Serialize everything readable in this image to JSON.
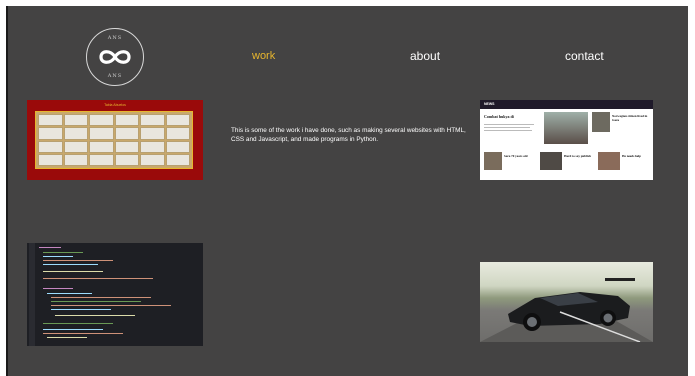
{
  "logo": {
    "top_text": "ANS",
    "bottom_text": "ANS",
    "icon": "infinity-icon"
  },
  "nav": {
    "work": "work",
    "about": "about",
    "contact": "contact",
    "active_color": "#e8b62e"
  },
  "description": "This is some of the work i have done, such as making several websites with HTML, CSS and Javascript, and made programs in Python.",
  "thumbnails": {
    "table_site": {
      "title": "Tabla Abuelos"
    },
    "news_site": {
      "logo": "NEWS",
      "headlines": [
        "Combat hukya di",
        "Norwegian citizen lived in Gaza",
        "Sara 70 years old",
        "Hard to say publish",
        "He needs help"
      ]
    },
    "code": {},
    "car": {}
  },
  "colors": {
    "background": "#444343",
    "accent": "#e8b62e"
  }
}
